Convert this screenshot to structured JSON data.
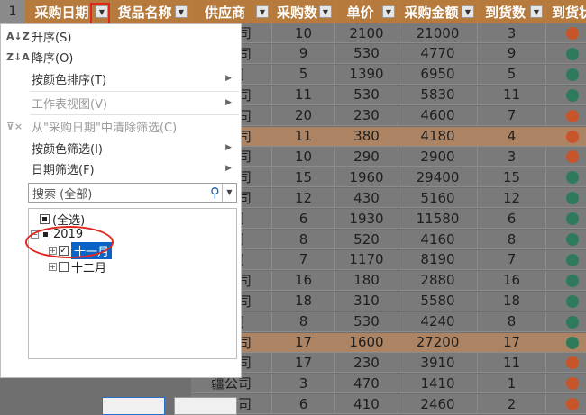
{
  "row_number": "1",
  "columns": [
    {
      "label": "采购日期",
      "w": 96
    },
    {
      "label": "货品名称",
      "w": 88
    },
    {
      "label": "供应商",
      "w": 90
    },
    {
      "label": "采购数",
      "w": 70
    },
    {
      "label": "单价",
      "w": 70
    },
    {
      "label": "采购金额",
      "w": 88
    },
    {
      "label": "到货数",
      "w": 76
    },
    {
      "label": "到货状",
      "w": 72
    }
  ],
  "rows": [
    {
      "supplier": "限公司",
      "qty": "10",
      "price": "2100",
      "amount": "21000",
      "arrived": "3",
      "status_color": "#c8542a",
      "hl": false
    },
    {
      "supplier": "限公司",
      "qty": "9",
      "price": "530",
      "amount": "4770",
      "arrived": "9",
      "status_color": "#2e7a5c",
      "hl": false
    },
    {
      "supplier": "公司",
      "qty": "5",
      "price": "1390",
      "amount": "6950",
      "arrived": "5",
      "status_color": "#2e7a5c",
      "hl": false
    },
    {
      "supplier": "限公司",
      "qty": "11",
      "price": "530",
      "amount": "5830",
      "arrived": "11",
      "status_color": "#2e7a5c",
      "hl": false
    },
    {
      "supplier": "限公司",
      "qty": "20",
      "price": "230",
      "amount": "4600",
      "arrived": "7",
      "status_color": "#c8542a",
      "hl": false
    },
    {
      "supplier": "限公司",
      "qty": "11",
      "price": "380",
      "amount": "4180",
      "arrived": "4",
      "status_color": "#c8542a",
      "hl": true
    },
    {
      "supplier": "限公司",
      "qty": "10",
      "price": "290",
      "amount": "2900",
      "arrived": "3",
      "status_color": "#c8542a",
      "hl": false
    },
    {
      "supplier": "疆公司",
      "qty": "15",
      "price": "1960",
      "amount": "29400",
      "arrived": "15",
      "status_color": "#2e7a5c",
      "hl": false
    },
    {
      "supplier": "限公司",
      "qty": "12",
      "price": "430",
      "amount": "5160",
      "arrived": "12",
      "status_color": "#2e7a5c",
      "hl": false
    },
    {
      "supplier": "公司",
      "qty": "6",
      "price": "1930",
      "amount": "11580",
      "arrived": "6",
      "status_color": "#2e7a5c",
      "hl": false
    },
    {
      "supplier": "公司",
      "qty": "8",
      "price": "520",
      "amount": "4160",
      "arrived": "8",
      "status_color": "#2e7a5c",
      "hl": false
    },
    {
      "supplier": "公司",
      "qty": "7",
      "price": "1170",
      "amount": "8190",
      "arrived": "7",
      "status_color": "#2e7a5c",
      "hl": false
    },
    {
      "supplier": "疆公司",
      "qty": "16",
      "price": "180",
      "amount": "2880",
      "arrived": "16",
      "status_color": "#2e7a5c",
      "hl": false
    },
    {
      "supplier": "疆公司",
      "qty": "18",
      "price": "310",
      "amount": "5580",
      "arrived": "18",
      "status_color": "#2e7a5c",
      "hl": false
    },
    {
      "supplier": "公司",
      "qty": "8",
      "price": "530",
      "amount": "4240",
      "arrived": "8",
      "status_color": "#2e7a5c",
      "hl": false
    },
    {
      "supplier": "疆公司",
      "qty": "17",
      "price": "1600",
      "amount": "27200",
      "arrived": "17",
      "status_color": "#2e7a5c",
      "hl": true
    },
    {
      "supplier": "疆公司",
      "qty": "17",
      "price": "230",
      "amount": "3910",
      "arrived": "11",
      "status_color": "#c8542a",
      "hl": false
    },
    {
      "supplier": "疆公司",
      "qty": "3",
      "price": "470",
      "amount": "1410",
      "arrived": "1",
      "status_color": "#c8542a",
      "hl": false
    },
    {
      "supplier": "疆公司",
      "qty": "6",
      "price": "410",
      "amount": "2460",
      "arrived": "2",
      "status_color": "#c8542a",
      "hl": false
    }
  ],
  "menu": {
    "sort_asc": "升序(S)",
    "sort_desc": "降序(O)",
    "sort_by_color": "按颜色排序(T)",
    "sheet_view": "工作表视图(V)",
    "clear_filter": "从\"采购日期\"中清除筛选(C)",
    "filter_by_color": "按颜色筛选(I)",
    "date_filter": "日期筛选(F)"
  },
  "search": {
    "placeholder": "搜索 (全部)"
  },
  "tree": {
    "select_all": "(全选)",
    "year": "2019",
    "month_nov": "十一月",
    "month_dec": "十二月"
  },
  "colors": {
    "header": "#b57a3c",
    "accent": "#0a64c8",
    "annotation": "#e0261d"
  }
}
